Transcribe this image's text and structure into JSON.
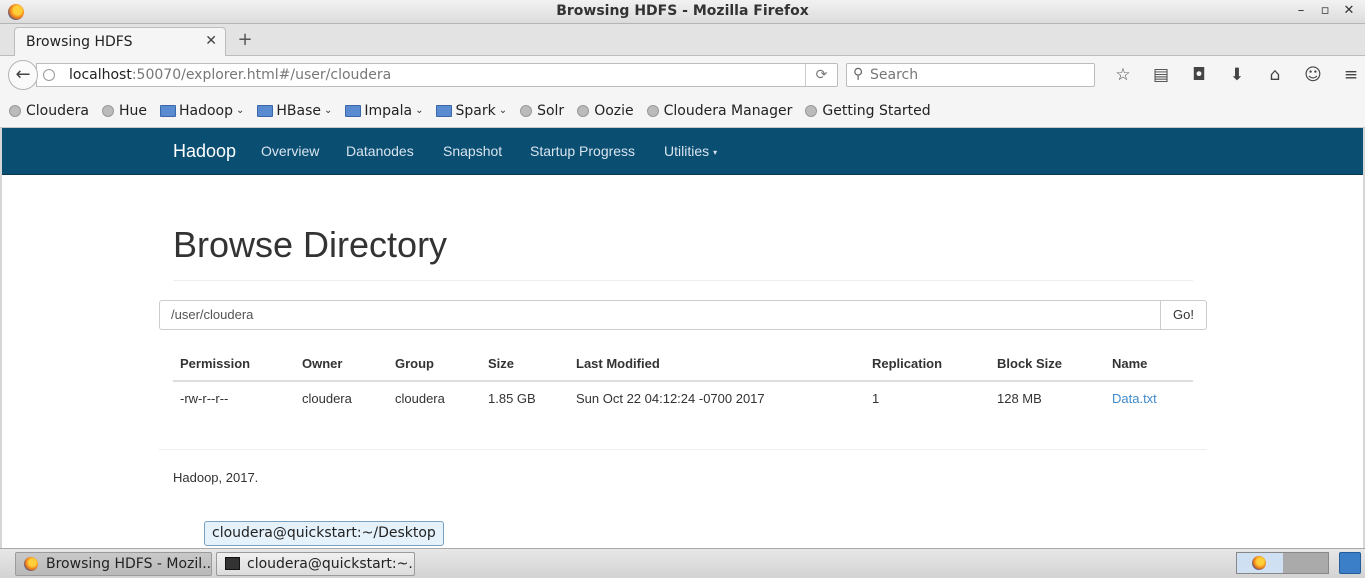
{
  "window": {
    "title": "Browsing HDFS - Mozilla Firefox",
    "controls": [
      "–",
      "▫",
      "✕"
    ]
  },
  "tabs": [
    {
      "label": "Browsing HDFS",
      "close": "✕"
    }
  ],
  "newtab": "+",
  "nav": {
    "back": "←",
    "url_host": "localhost",
    "url_rest": ":50070/explorer.html#/user/cloudera",
    "reload": "⟳",
    "search_placeholder": "Search",
    "search_icon": "⚲",
    "tools": [
      "☆",
      "▤",
      "◘",
      "⬇",
      "⌂",
      "☺",
      "≡"
    ]
  },
  "bookmarks": [
    {
      "label": "Cloudera",
      "kind": "globe"
    },
    {
      "label": "Hue",
      "kind": "globe"
    },
    {
      "label": "Hadoop",
      "kind": "folder",
      "caret": "⌄"
    },
    {
      "label": "HBase",
      "kind": "folder",
      "caret": "⌄"
    },
    {
      "label": "Impala",
      "kind": "folder",
      "caret": "⌄"
    },
    {
      "label": "Spark",
      "kind": "folder",
      "caret": "⌄"
    },
    {
      "label": "Solr",
      "kind": "globe"
    },
    {
      "label": "Oozie",
      "kind": "globe"
    },
    {
      "label": "Cloudera Manager",
      "kind": "globe"
    },
    {
      "label": "Getting Started",
      "kind": "globe"
    }
  ],
  "hadoop_nav": {
    "brand": "Hadoop",
    "items": [
      "Overview",
      "Datanodes",
      "Snapshot",
      "Startup Progress",
      "Utilities"
    ],
    "utilities_caret": "▾"
  },
  "page": {
    "heading": "Browse Directory",
    "path_value": "/user/cloudera",
    "go_label": "Go!",
    "columns": [
      "Permission",
      "Owner",
      "Group",
      "Size",
      "Last Modified",
      "Replication",
      "Block Size",
      "Name"
    ],
    "rows": [
      [
        "-rw-r--r--",
        "cloudera",
        "cloudera",
        "1.85 GB",
        "Sun Oct 22 04:12:24 -0700 2017",
        "1",
        "128 MB",
        "Data.txt"
      ]
    ],
    "footer": "Hadoop, 2017."
  },
  "tooltip": "cloudera@quickstart:~/Desktop",
  "taskbar": {
    "tasks": [
      {
        "label": "Browsing HDFS - Mozil...",
        "icon": "firefox-icon",
        "active": true
      },
      {
        "label": "cloudera@quickstart:~...",
        "icon": "terminal-icon",
        "active": false
      }
    ]
  },
  "colors": {
    "hadoop_nav_bg": "#0a4e72",
    "link": "#428bca"
  }
}
